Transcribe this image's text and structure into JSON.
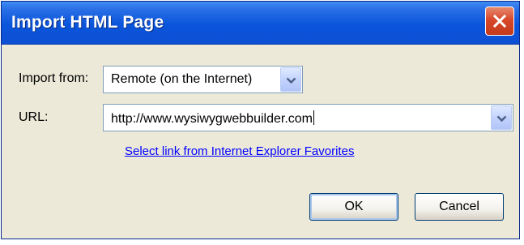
{
  "dialog": {
    "title": "Import HTML Page",
    "close_icon": "close-x-icon"
  },
  "import_from": {
    "label": "Import from:",
    "selected": "Remote (on the Internet)"
  },
  "url": {
    "label": "URL:",
    "value": "http://www.wysiwygwebbuilder.com"
  },
  "favorites_link": "Select link from Internet Explorer Favorites",
  "buttons": {
    "ok": "OK",
    "cancel": "Cancel"
  },
  "colors": {
    "titlebar": "#0a55dc",
    "close": "#d8472a",
    "dialog_bg": "#ece9d8",
    "link": "#0000ff"
  }
}
